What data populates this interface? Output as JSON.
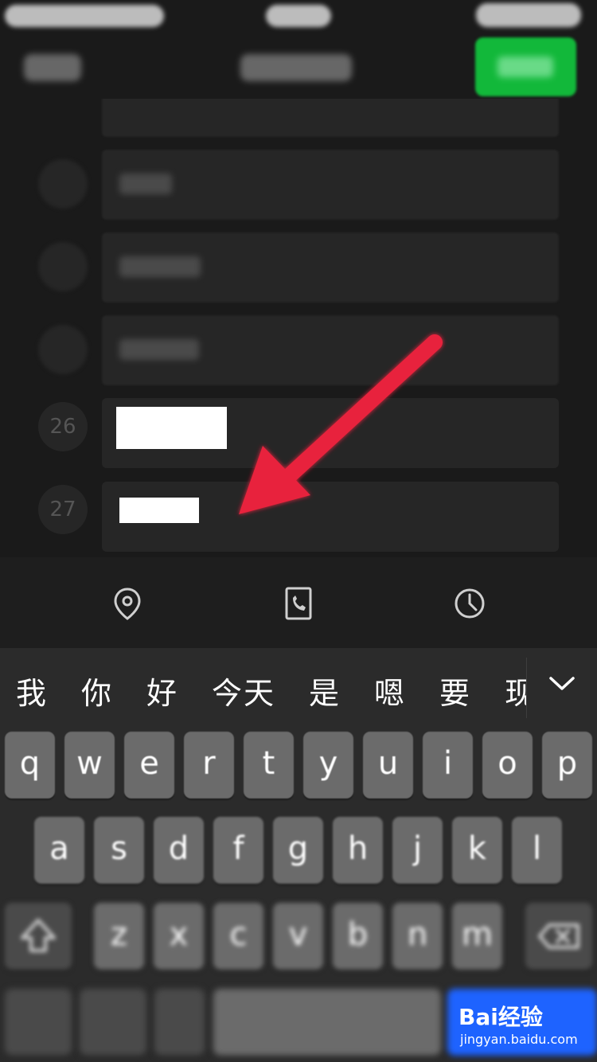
{
  "list": {
    "visible_numbers": [
      "26",
      "27"
    ]
  },
  "candidates": [
    "我",
    "你",
    "好",
    "今天",
    "是",
    "嗯",
    "要",
    "现"
  ],
  "keyboard": {
    "row1": [
      "q",
      "w",
      "e",
      "r",
      "t",
      "y",
      "u",
      "i",
      "o",
      "p"
    ],
    "row2": [
      "a",
      "s",
      "d",
      "f",
      "g",
      "h",
      "j",
      "k",
      "l"
    ],
    "row3": [
      "z",
      "x",
      "c",
      "v",
      "b",
      "n",
      "m"
    ]
  },
  "icons": {
    "toolbar": [
      "location-icon",
      "phone-card-icon",
      "clock-icon"
    ],
    "collapse": "chevron-down-icon",
    "shift": "shift-icon",
    "delete": "delete-icon"
  },
  "colors": {
    "done_button": "#12b83a",
    "annotation_arrow": "#e8243c",
    "return_key": "#1e63ff"
  },
  "watermark": {
    "brand": "Bai经验",
    "url": "jingyan.baidu.com"
  }
}
